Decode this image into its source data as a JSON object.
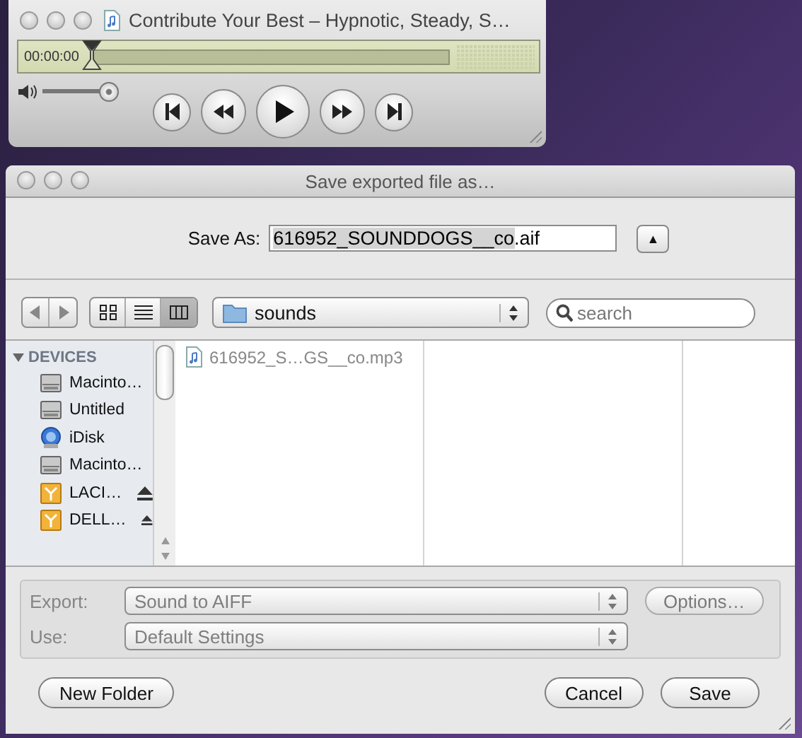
{
  "player": {
    "title": "Contribute Your Best – Hypnotic, Steady, S…",
    "time": "00:00:00",
    "position": {
      "level": 0.0
    },
    "volume": {
      "level": 0.9
    },
    "controls": [
      {
        "kind": "previous"
      },
      {
        "kind": "rewind"
      },
      {
        "kind": "play"
      },
      {
        "kind": "forward"
      },
      {
        "kind": "next"
      }
    ]
  },
  "dialog": {
    "title": "Save exported file as…",
    "save_as_label": "Save As:",
    "filename": {
      "selected_text": "616952_SOUNDDOGS__co",
      "rest_text": ".aif"
    },
    "expand_button": "▲",
    "view_modes": [
      {
        "kind": "icons",
        "selected": false
      },
      {
        "kind": "list",
        "selected": false
      },
      {
        "kind": "columns",
        "selected": true
      }
    ],
    "location": "sounds",
    "search": {
      "placeholder": "search"
    },
    "sidebar": {
      "section": "DEVICES",
      "expanded": true,
      "items": [
        {
          "label": "Macinto…",
          "kind": "disk",
          "eject": false
        },
        {
          "label": "Untitled",
          "kind": "disk",
          "eject": false
        },
        {
          "label": "iDisk",
          "kind": "idisk",
          "eject": false
        },
        {
          "label": "Macinto…",
          "kind": "disk",
          "eject": false
        },
        {
          "label": "LACI…",
          "kind": "external",
          "eject": true
        },
        {
          "label": "DELL…",
          "kind": "external",
          "eject": true
        }
      ]
    },
    "files": [
      {
        "name": "616952_S…GS__co.mp3"
      }
    ],
    "options": [
      {
        "label": "Export:",
        "value": "Sound to AIFF",
        "disabled": true
      },
      {
        "label": "Use:",
        "value": "Default Settings",
        "disabled": true
      }
    ],
    "options_button": {
      "label": "Options…",
      "disabled": true
    },
    "buttons": [
      {
        "label": "New Folder",
        "kind": "secondary"
      },
      {
        "label": "Cancel",
        "kind": "secondary"
      },
      {
        "label": "Save",
        "kind": "primary"
      }
    ]
  }
}
